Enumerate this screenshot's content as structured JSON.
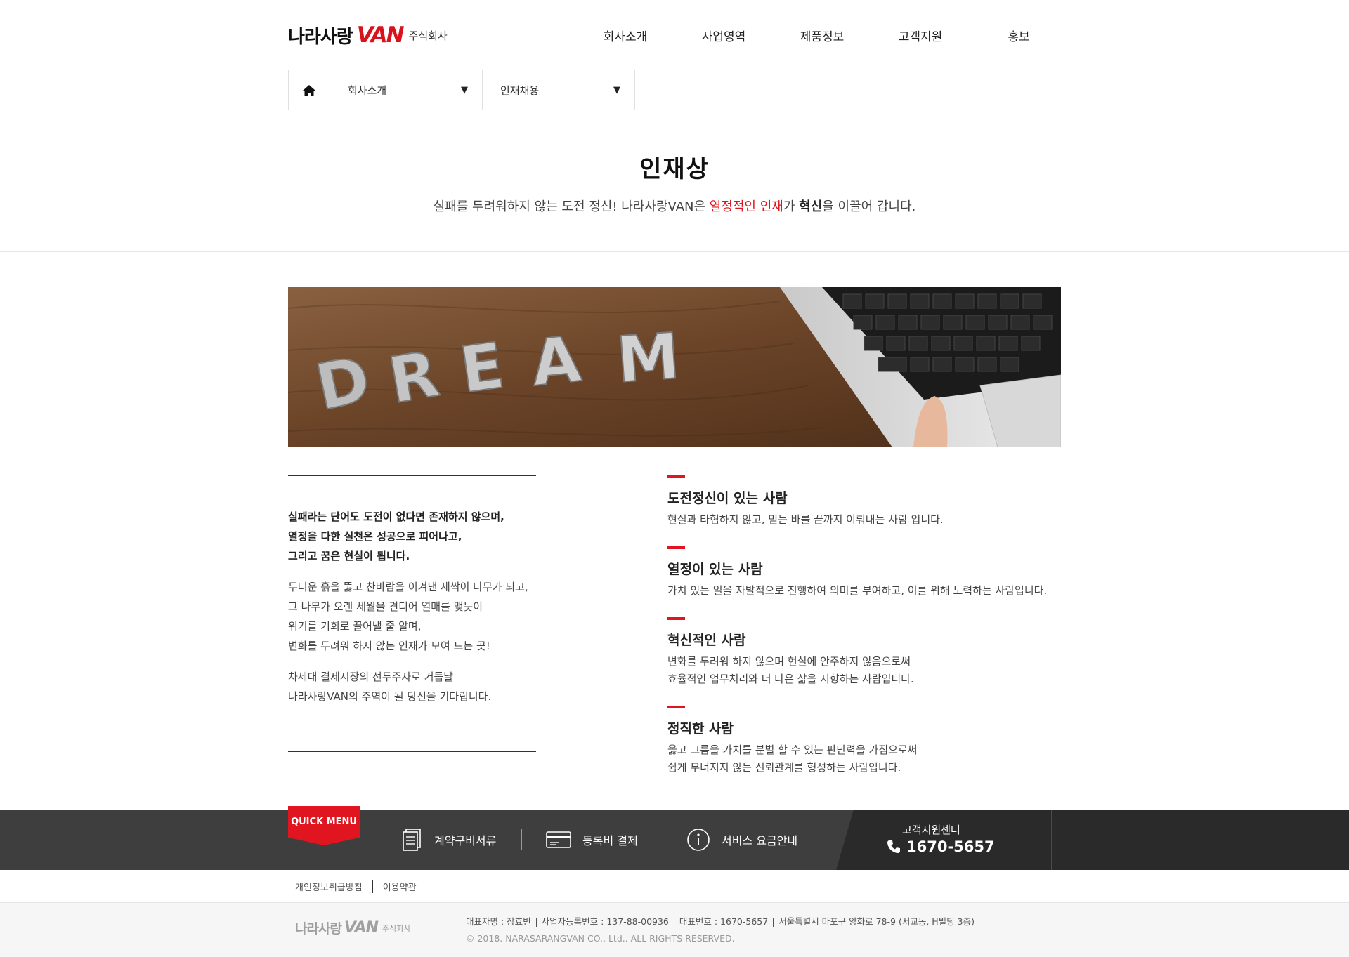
{
  "header": {
    "logo_text": "나라사랑",
    "logo_van": "VAN",
    "logo_sub": "주식회사",
    "nav": [
      "회사소개",
      "사업영역",
      "제품정보",
      "고객지원",
      "홍보"
    ]
  },
  "subnav": {
    "depth1": "회사소개",
    "depth2": "인재채용"
  },
  "page": {
    "title": "인재상",
    "desc_part1": "실패를 두려워하지 않는 도전 정신! 나라사랑VAN은 ",
    "desc_red": "열정적인 인재",
    "desc_part2": "가 ",
    "desc_bold": "혁신",
    "desc_part3": "을 이끌어 갑니다."
  },
  "banner": {
    "letters": [
      "D",
      "R",
      "E",
      "A",
      "M"
    ]
  },
  "left": {
    "intro": [
      "실패라는 단어도 도전이 없다면 존재하지 않으며,",
      "열정을 다한 실천은 성공으로 피어나고,",
      "그리고 꿈은 현실이 됩니다."
    ],
    "para1": [
      "두터운 흙을 뚫고 찬바람을 이겨낸 새싹이 나무가 되고,",
      "그 나무가 오랜 세월을 견디어 열매를 맺듯이",
      "위기를 기회로 끌어낼 줄 알며,",
      "변화를 두려워 하지 않는 인재가 모여 드는 곳!"
    ],
    "para2": [
      "차세대 결제시장의 선두주자로 거듭날",
      "나라사랑VAN의 주역이 될 당신을 기다립니다."
    ]
  },
  "traits": [
    {
      "title": "도전정신이 있는 사람",
      "lines": [
        "현실과 타협하지 않고, 믿는 바를 끝까지 이뤄내는 사람 입니다."
      ]
    },
    {
      "title": "열정이 있는 사람",
      "lines": [
        "가치 있는 일을 자발적으로 진행하여 의미를 부여하고, 이를 위해 노력하는 사람입니다."
      ]
    },
    {
      "title": "혁신적인 사람",
      "lines": [
        "변화를 두려워 하지 않으며 현실에 안주하지 않음으로써",
        "효율적인 업무처리와 더 나은 삶을 지향하는 사람입니다."
      ]
    },
    {
      "title": "정직한 사람",
      "lines": [
        "옳고 그름을 가치를 분별 할 수 있는 판단력을 가짐으로써",
        "쉽게 무너지지 않는 신뢰관계를 형성하는 사람입니다."
      ]
    }
  ],
  "quick": {
    "tab": "QUICK MENU",
    "items": [
      "계약구비서류",
      "등록비 결제",
      "서비스 요금안내"
    ],
    "support_label": "고객지원센터",
    "support_phone": "1670-5657"
  },
  "policy": {
    "privacy": "개인정보취급방침",
    "terms": "이용약관"
  },
  "footer": {
    "logo_text": "나라사랑",
    "logo_van": "VAN",
    "logo_sub": "주식회사",
    "ceo": "대표자명 : 장효빈",
    "biz_no": "사업자등록번호 : 137-88-00936",
    "tel": "대표번호 : 1670-5657",
    "address": "서울특별시 마포구 양화로 78-9 (서교동, H빌딩 3층)",
    "copyright": "© 2018. NARASARANGVAN CO., Ltd.. ALL RIGHTS RESERVED."
  },
  "colors": {
    "accent": "#e0151f",
    "quick_bg": "#3e3e3e",
    "quick_dark": "#2a2a2a"
  }
}
